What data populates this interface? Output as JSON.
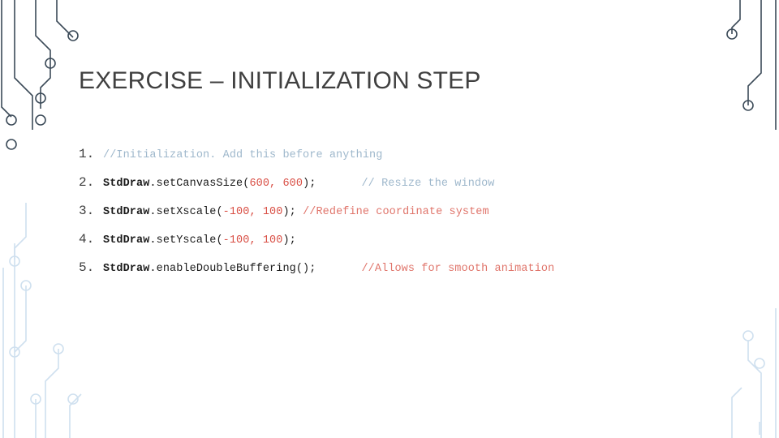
{
  "slide": {
    "title": "EXERCISE – INITIALIZATION STEP",
    "background": "#ffffff",
    "title_color": "#404040",
    "accent_colors": {
      "circuit_dark": "#3b4a58",
      "circuit_light": "#cfe0ef",
      "comment_blue": "#9fb8cc",
      "comment_red": "#e0756b",
      "number_red": "#d94f45"
    },
    "lines": [
      {
        "number": "1.",
        "parts": [
          {
            "text": "//",
            "style": "comment"
          },
          {
            "text": "Initialization. Add this before anything",
            "style": "comment"
          }
        ]
      },
      {
        "number": "2.",
        "parts": [
          {
            "text": "StdDraw",
            "style": "object"
          },
          {
            "text": ".setCanvasSize",
            "style": "method"
          },
          {
            "text": "(",
            "style": "punct"
          },
          {
            "text": "600, 600",
            "style": "number"
          },
          {
            "text": ");",
            "style": "punct"
          },
          {
            "text": "        ",
            "style": "gap"
          },
          {
            "text": "// Resize the window",
            "style": "comment"
          }
        ]
      },
      {
        "number": "3.",
        "parts": [
          {
            "text": "StdDraw",
            "style": "object"
          },
          {
            "text": ".setXscale",
            "style": "method"
          },
          {
            "text": "(",
            "style": "punct"
          },
          {
            "text": "-100, 100",
            "style": "number"
          },
          {
            "text": "); ",
            "style": "punct"
          },
          {
            "text": "//Redefine coordinate system",
            "style": "comment-red"
          }
        ]
      },
      {
        "number": "4.",
        "parts": [
          {
            "text": "StdDraw",
            "style": "object"
          },
          {
            "text": ".setYscale",
            "style": "method"
          },
          {
            "text": "(",
            "style": "punct"
          },
          {
            "text": "-100, 100",
            "style": "number"
          },
          {
            "text": ");",
            "style": "punct"
          }
        ]
      },
      {
        "number": "5.",
        "parts": [
          {
            "text": "StdDraw",
            "style": "object"
          },
          {
            "text": ".enableDoubleBuffering",
            "style": "method"
          },
          {
            "text": "();",
            "style": "punct"
          },
          {
            "text": "        ",
            "style": "gap"
          },
          {
            "text": "//Allows for smooth animation",
            "style": "comment-red"
          }
        ]
      }
    ]
  }
}
